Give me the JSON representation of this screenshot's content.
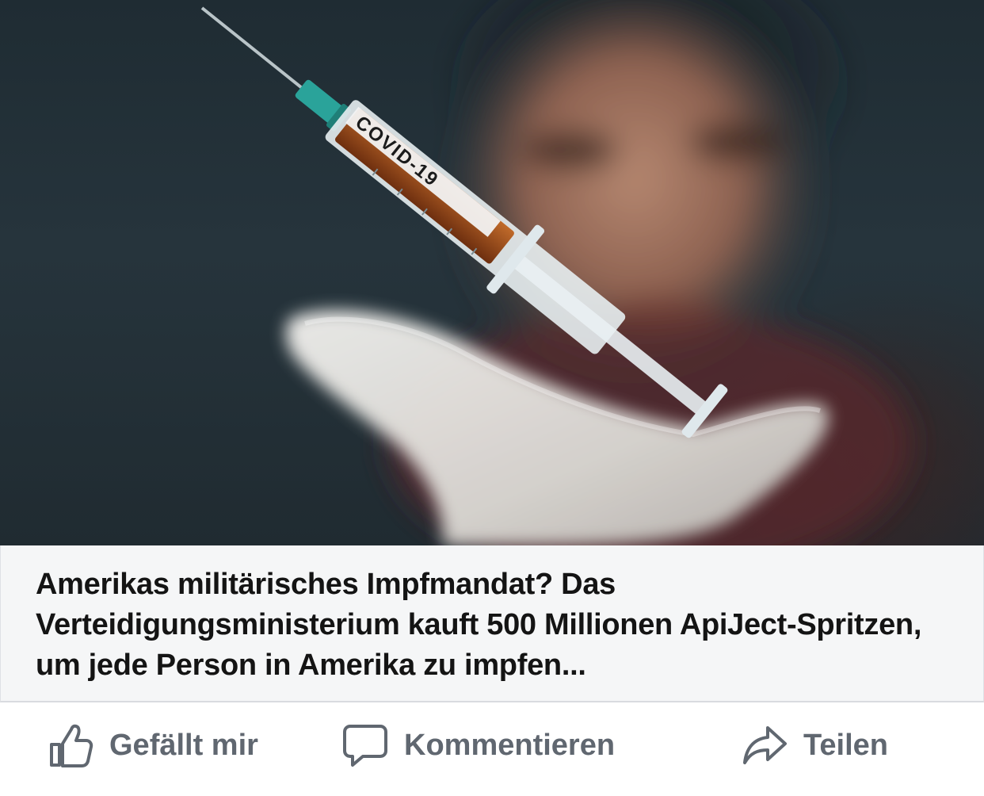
{
  "hero_image": {
    "syringe_label": "COVID-19"
  },
  "link_preview": {
    "headline": "Amerikas militärisches Impfmandat? Das Verteidigungsministerium kauft 500 Millionen ApiJect-Spritzen, um jede Person in Amerika zu impfen..."
  },
  "actions": {
    "like": {
      "label": "Gefällt mir",
      "icon": "thumbs-up-icon"
    },
    "comment": {
      "label": "Kommentieren",
      "icon": "speech-bubble-icon"
    },
    "share": {
      "label": "Teilen",
      "icon": "share-arrow-icon"
    }
  },
  "colors": {
    "caption_background": "#f5f6f7",
    "headline_text": "#141414",
    "action_text": "#606770"
  }
}
